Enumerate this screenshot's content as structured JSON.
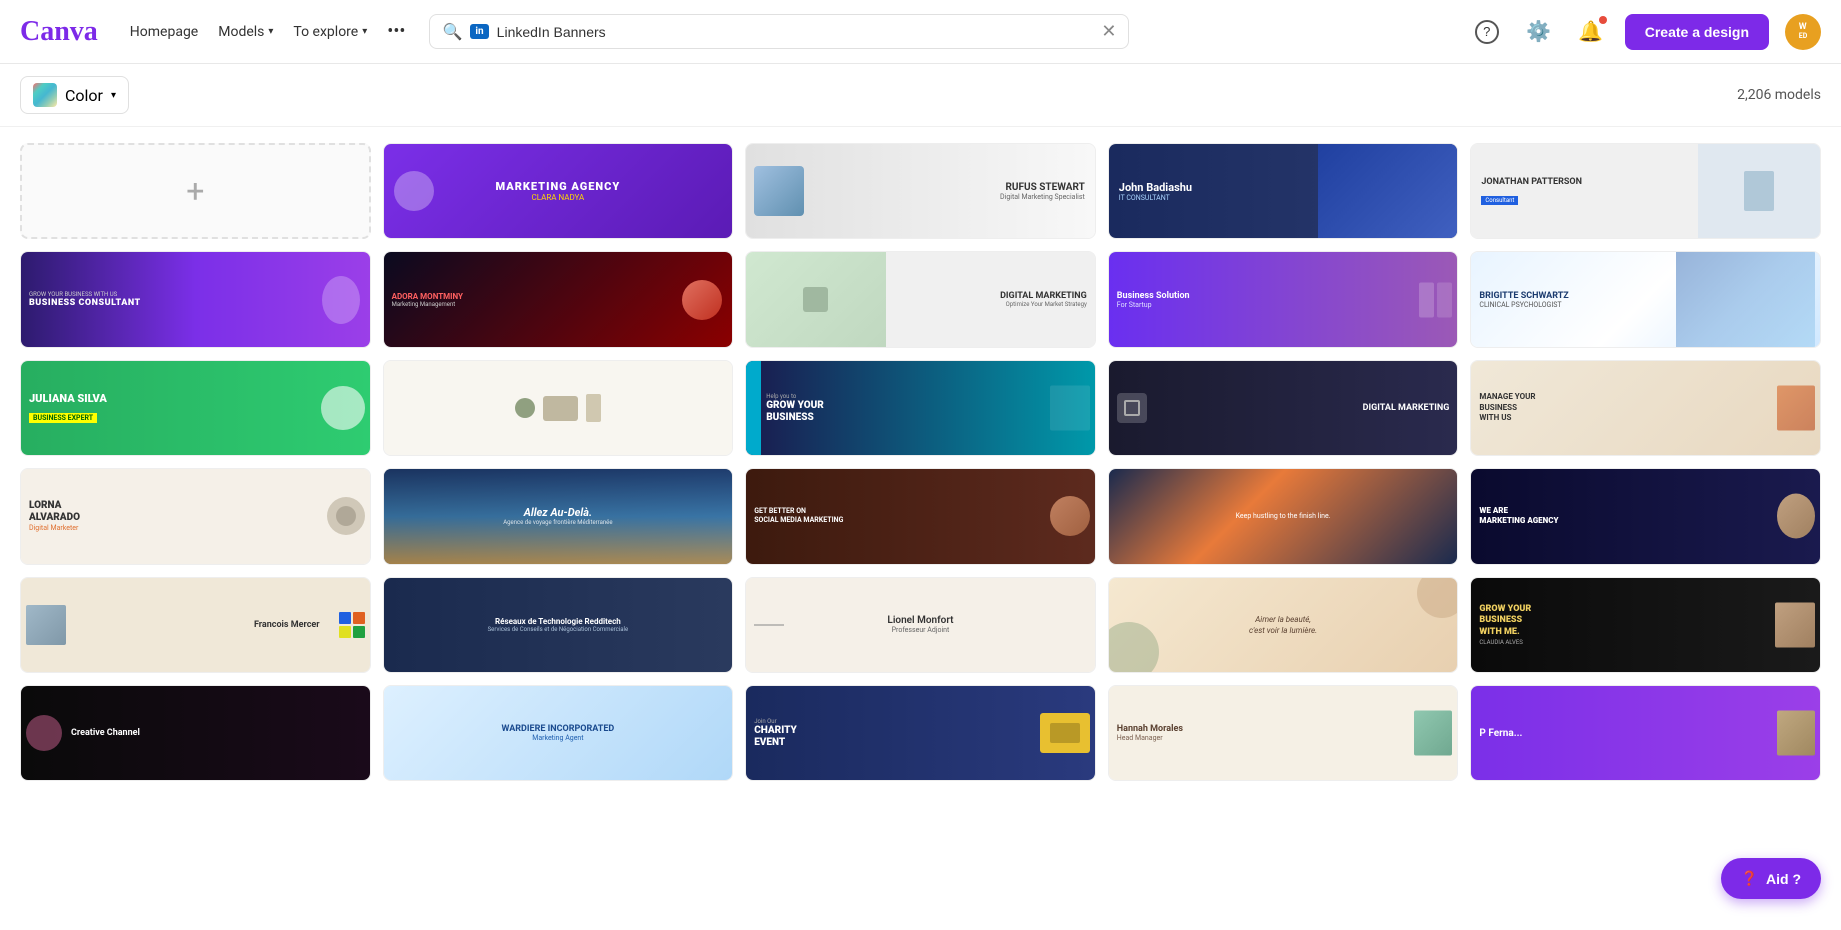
{
  "header": {
    "logo": "Canva",
    "nav": [
      {
        "label": "Homepage",
        "has_dropdown": false
      },
      {
        "label": "Models",
        "has_dropdown": true
      },
      {
        "label": "To explore",
        "has_dropdown": true
      }
    ],
    "more_label": "•••",
    "search": {
      "badge": "in",
      "value": "LinkedIn Banners",
      "placeholder": "Search"
    },
    "help_icon": "?",
    "settings_icon": "⚙",
    "notification_icon": "🔔",
    "create_btn": "Create a design",
    "avatar_initials": "W ED"
  },
  "toolbar": {
    "color_filter_label": "Color",
    "model_count": "2,206 models"
  },
  "add_card": {
    "symbol": "+"
  },
  "templates": [
    {
      "id": "marketing-agency",
      "title": "MARKETING AGENCY",
      "subtitle": "CLARA NADYA",
      "style": "t-marketing-agency",
      "text_color": "white"
    },
    {
      "id": "rufus-stewart",
      "title": "RUFUS STEWART",
      "subtitle": "Digital Marketing Specialist",
      "style": "t-rufus",
      "text_color": "dark"
    },
    {
      "id": "john-badiashu",
      "title": "John Badiashu",
      "subtitle": "IT CONSULTANT",
      "style": "t-john",
      "text_color": "white"
    },
    {
      "id": "jonathan-patterson",
      "title": "JONATHAN PATTERSON",
      "subtitle": "",
      "style": "t-jonathan",
      "text_color": "dark"
    },
    {
      "id": "biz-consultant",
      "title": "BUSINESS CONSULTANT",
      "subtitle": "",
      "style": "t-biz-consultant",
      "text_color": "white"
    },
    {
      "id": "adora-montminy",
      "title": "ADORA MONTMINY",
      "subtitle": "Marketing Management",
      "style": "t-adora",
      "text_color": "white"
    },
    {
      "id": "digital-marketing",
      "title": "DIGITAL MARKETING",
      "subtitle": "Optimize Your Market Strategy",
      "style": "t-digital-mktg",
      "text_color": "dark"
    },
    {
      "id": "biz-solution",
      "title": "Business Solution For Startup",
      "subtitle": "",
      "style": "t-biz-solution",
      "text_color": "white"
    },
    {
      "id": "brigitte-schwartz",
      "title": "BRIGITTE SCHWARTZ",
      "subtitle": "CLINICAL PSYCHOLOGIST",
      "style": "t-brigitte",
      "text_color": "dark"
    },
    {
      "id": "juliana-silva",
      "title": "JULIANA SILVA",
      "subtitle": "BUSINESS EXPERT",
      "style": "t-juliana",
      "text_color": "white"
    },
    {
      "id": "minimal-desk",
      "title": "",
      "subtitle": "",
      "style": "t-minimal-desk",
      "text_color": "dark"
    },
    {
      "id": "grow-business",
      "title": "GROW YOUR BUSINESS",
      "subtitle": "Help you to",
      "style": "t-grow-biz",
      "text_color": "white"
    },
    {
      "id": "digital-marketing2",
      "title": "DIGITAL MARKETING",
      "subtitle": "",
      "style": "t-digital-mktg2",
      "text_color": "white"
    },
    {
      "id": "manage-business",
      "title": "MANAGE YOUR BUSINESS WITH US",
      "subtitle": "",
      "style": "t-manage-biz",
      "text_color": "dark"
    },
    {
      "id": "lorna-alvarado",
      "title": "LORNA ALVARADO",
      "subtitle": "Digital Marketer",
      "style": "t-lorna",
      "text_color": "dark"
    },
    {
      "id": "allez-au-dela",
      "title": "Allez Au-Delà.",
      "subtitle": "Agence de voyage frontière Méditerranée",
      "style": "t-allez",
      "text_color": "white"
    },
    {
      "id": "social-media",
      "title": "GET BETTER ON SOCIAL MEDIA MARKETING",
      "subtitle": "",
      "style": "t-social-media",
      "text_color": "white"
    },
    {
      "id": "hustling",
      "title": "Keep hustling to the finish line.",
      "subtitle": "",
      "style": "t-hustling",
      "text_color": "white"
    },
    {
      "id": "marketing-agency2",
      "title": "WE ARE MARKETING AGENCY",
      "subtitle": "",
      "style": "t-marketing-agency2",
      "text_color": "white"
    },
    {
      "id": "francois-mercer",
      "title": "Francois Mercer",
      "subtitle": "",
      "style": "t-francois",
      "text_color": "dark"
    },
    {
      "id": "reseaux-redditech",
      "title": "Réseaux de Technologie Redditech",
      "subtitle": "Services de Conseils et de Négociation Commerciale",
      "style": "t-reseaux",
      "text_color": "white"
    },
    {
      "id": "lionel-monfort",
      "title": "Lionel Monfort",
      "subtitle": "Professeur Adjoint",
      "style": "t-lionel",
      "text_color": "dark"
    },
    {
      "id": "aimer-beaute",
      "title": "Aimer la beauté, c'est voir la lumière.",
      "subtitle": "",
      "style": "t-aimer",
      "text_color": "dark"
    },
    {
      "id": "grow-biz2",
      "title": "GROW YOUR BUSINESS WITH ME.",
      "subtitle": "CLAUDIA ALVES",
      "style": "t-grow-biz2",
      "text_color": "white"
    },
    {
      "id": "creative-channel",
      "title": "Creative Channel",
      "subtitle": "",
      "style": "t-creative",
      "text_color": "white"
    },
    {
      "id": "wardiere",
      "title": "WARDIERE INCORPORATED",
      "subtitle": "Marketing Agent",
      "style": "t-wardiere",
      "text_color": "dark"
    },
    {
      "id": "charity-event",
      "title": "Join Our CHARITY EVENT",
      "subtitle": "",
      "style": "t-charity",
      "text_color": "white"
    },
    {
      "id": "hannah-morales",
      "title": "Hannah Morales",
      "subtitle": "Head Manager",
      "style": "t-hannah",
      "text_color": "dark"
    },
    {
      "id": "pedro",
      "title": "P Ferna...",
      "subtitle": "",
      "style": "t-pedro",
      "text_color": "white"
    }
  ],
  "aid_button": "Aid ?"
}
